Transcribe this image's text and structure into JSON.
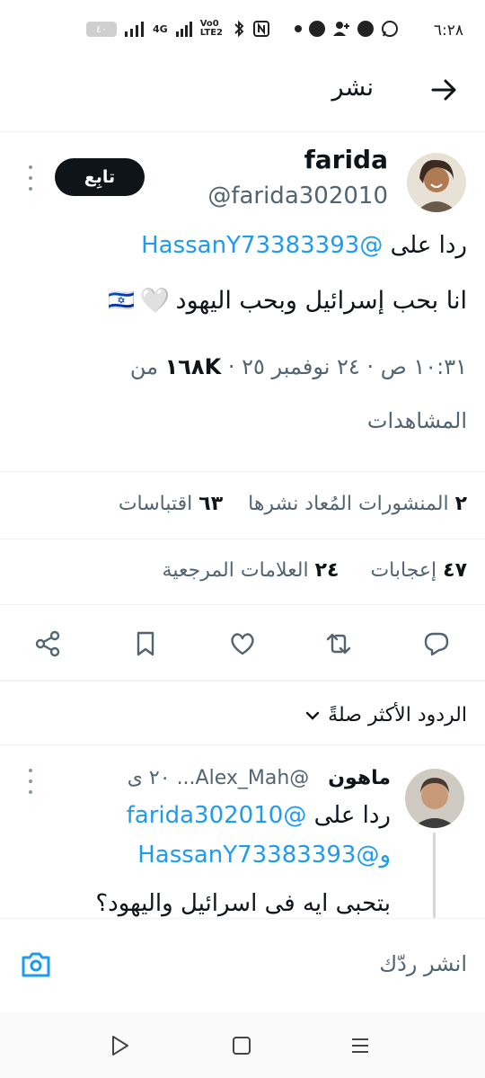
{
  "status_bar": {
    "time": "٦:٢٨",
    "battery": "٤٠",
    "network": "4G",
    "volte": "Vo‪0‬ LTE2"
  },
  "header": {
    "title": "نشر"
  },
  "tweet": {
    "name": "farida",
    "handle": "@farida302010",
    "follow_label": "تابِع",
    "replying_prefix": "ردا على",
    "replying_to": "@HassanY73383393",
    "text": "انا بحب إسرائيل وبحب اليهود",
    "emoji": "🤍",
    "flag": "🇮🇱",
    "meta_time": "١٠:٣١ ص · ٢٤ نوفمبر ٢٥ ·",
    "views": "١٦٨K",
    "views_suffix_1": "من",
    "views_suffix_2": "المشاهدات",
    "reposts_count": "٢",
    "reposts_label": "المنشورات المُعاد نشرها",
    "quotes_count": "٦٣",
    "quotes_label": "اقتباسات",
    "likes_count": "٤٧",
    "likes_label": "إعجابات",
    "bookmarks_count": "٢٤",
    "bookmarks_label": "العلامات المرجعية"
  },
  "replies_section": {
    "title": "الردود الأكثر صلةً"
  },
  "reply": {
    "name": "ماهون",
    "handle": "@Alex_Mah...",
    "time": "٢٠ ى",
    "replying_prefix": "ردا على",
    "mention_1": "@farida302010",
    "mention_2": "و@HassanY73383393",
    "text": "بتحبى ايه فى اسرائيل واليهود؟"
  },
  "composer": {
    "placeholder": "انشر ردّك"
  },
  "icons": {
    "back": "arrow-right-icon",
    "share": "share-icon",
    "bookmark": "bookmark-icon",
    "like": "heart-icon",
    "repost": "repost-icon",
    "reply": "reply-icon",
    "camera": "camera-icon",
    "chevron": "chevron-down-icon"
  },
  "colors": {
    "accent": "#1d9bf0",
    "text": "#0f1419",
    "secondary": "#536471"
  }
}
